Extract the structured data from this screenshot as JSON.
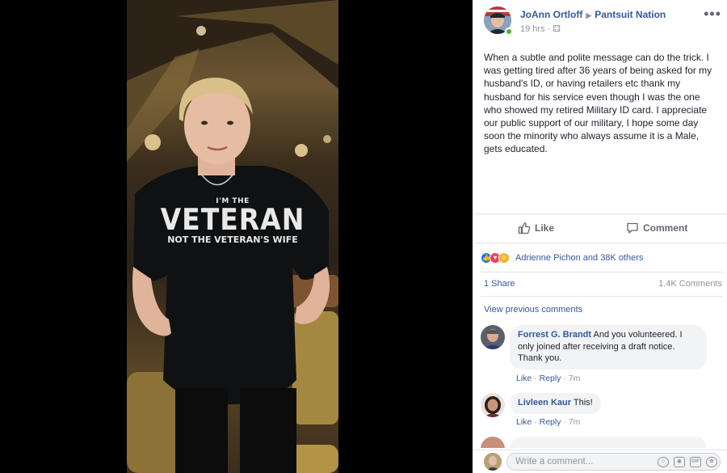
{
  "post": {
    "author": "JoAnn Ortloff",
    "group": "Pantsuit Nation",
    "time": "19 hrs",
    "text": "When a subtle and polite message can do the trick. I was getting tired after 36 years of being asked for my husband's ID, or having retailers etc thank my husband for his service even though I was the one who showed my retired Military ID card. I appreciate our public support of our military, I hope some day soon the minority who always assume it is a Male, gets educated."
  },
  "photo": {
    "shirt_small": "I'M THE",
    "shirt_big": "VETERAN",
    "shirt_sub": "NOT THE VETERAN'S WIFE"
  },
  "actions": {
    "like": "Like",
    "comment": "Comment"
  },
  "reactions": {
    "text": "Adrienne Pichon and 38K others"
  },
  "stats": {
    "shares": "1 Share",
    "comments": "1.4K Comments"
  },
  "view_previous": "View previous comments",
  "comments": [
    {
      "name": "Forrest G. Brandt",
      "text": "And you volunteered. I only joined after receiving a draft notice. Thank you.",
      "like": "Like",
      "reply": "Reply",
      "time": "7m"
    },
    {
      "name": "Livleen Kaur",
      "text": "This!",
      "like": "Like",
      "reply": "Reply",
      "time": "7m"
    }
  ],
  "composer": {
    "placeholder": "Write a comment..."
  },
  "icons": {
    "more": "more-options-icon",
    "privacy": "group-privacy-icon",
    "like": "thumbs-up-icon",
    "comment": "speech-bubble-icon",
    "emoji": "emoji-icon",
    "camera": "camera-icon",
    "gif": "gif-icon",
    "sticker": "sticker-icon"
  },
  "colors": {
    "link": "#365899",
    "secondary": "#90949c",
    "online": "#42b72a",
    "bubble": "#f2f3f5"
  }
}
